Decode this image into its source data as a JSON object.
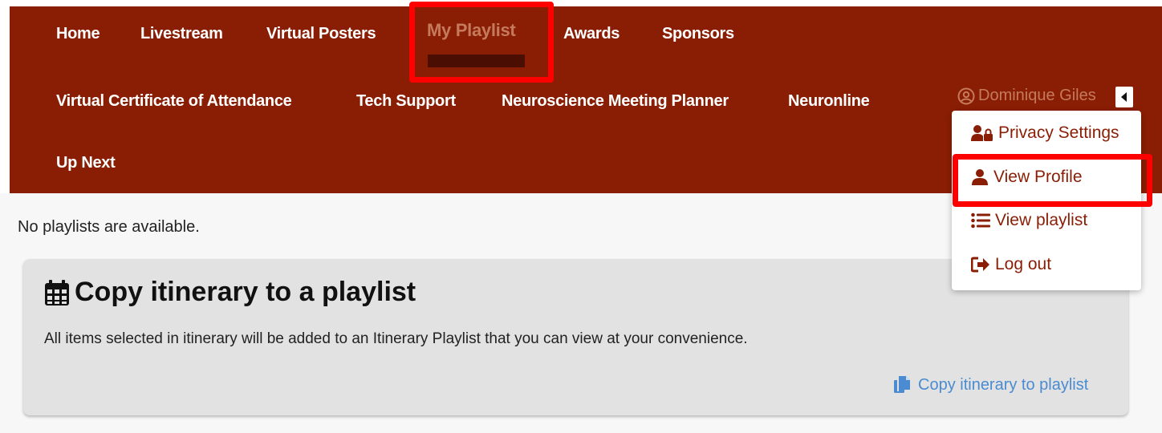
{
  "nav": {
    "home": "Home",
    "livestream": "Livestream",
    "virtual_posters": "Virtual Posters",
    "my_playlist": "My Playlist",
    "awards": "Awards",
    "sponsors": "Sponsors",
    "certificate": "Virtual Certificate of Attendance",
    "tech_support": "Tech Support",
    "meeting_planner": "Neuroscience Meeting Planner",
    "neuronline": "Neuronline",
    "up_next": "Up Next"
  },
  "user": {
    "name": "Dominique Giles",
    "icon": "user-circle-icon"
  },
  "user_menu": {
    "privacy": "Privacy Settings",
    "view_profile": "View Profile",
    "view_playlist": "View playlist",
    "log_out": "Log out"
  },
  "main": {
    "empty_message": "No playlists are available.",
    "card_title": "Copy itinerary to a playlist",
    "card_description": "All items selected in itinerary will be added to an Itinerary Playlist that you can view at your convenience.",
    "copy_link": "Copy itinerary to playlist"
  },
  "colors": {
    "navbar": "#8a1e04",
    "highlight": "#ff0000",
    "link_blue": "#4a8bd1",
    "card_bg": "#e2e2e2"
  }
}
